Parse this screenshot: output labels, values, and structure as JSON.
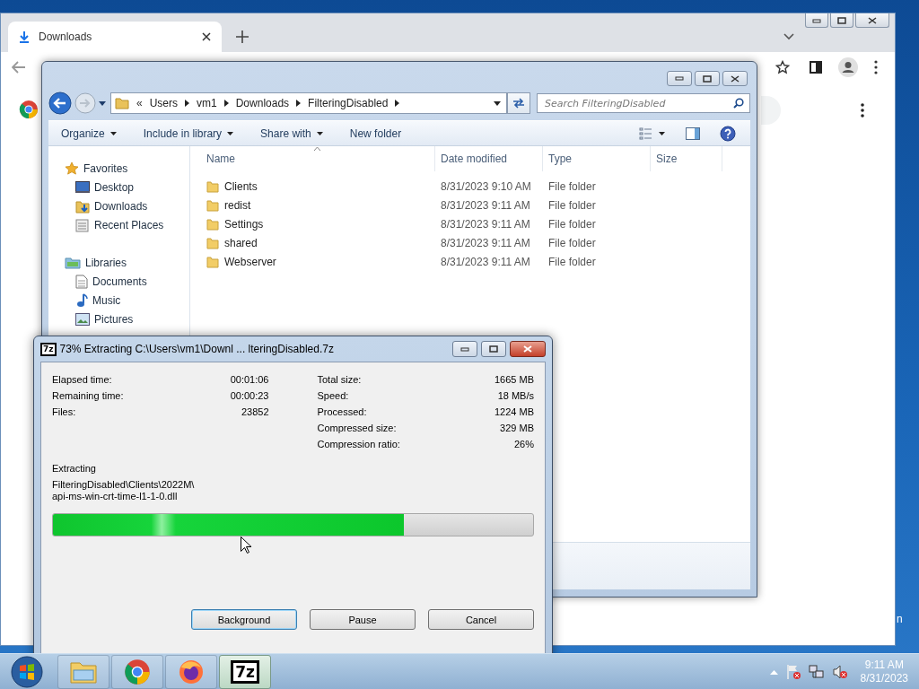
{
  "browser": {
    "tabs": [
      {
        "label": "Downloads",
        "selected": true
      }
    ]
  },
  "desktop": {
    "label_fragment": "n"
  },
  "explorer": {
    "address_overflow": "«",
    "breadcrumb": [
      "Users",
      "vm1",
      "Downloads",
      "FilteringDisabled"
    ],
    "search": {
      "placeholder": "Search FilteringDisabled"
    },
    "toolbar": [
      {
        "label": "Organize",
        "has_menu": true
      },
      {
        "label": "Include in library",
        "has_menu": true
      },
      {
        "label": "Share with",
        "has_menu": true
      },
      {
        "label": "New folder",
        "has_menu": false
      }
    ],
    "sidebar": [
      {
        "label": "Favorites",
        "kind": "favorites",
        "items": [
          {
            "label": "Desktop",
            "kind": "desktop"
          },
          {
            "label": "Downloads",
            "kind": "downloads"
          },
          {
            "label": "Recent Places",
            "kind": "recent"
          }
        ]
      },
      {
        "label": "Libraries",
        "kind": "libraries",
        "items": [
          {
            "label": "Documents",
            "kind": "documents"
          },
          {
            "label": "Music",
            "kind": "music"
          },
          {
            "label": "Pictures",
            "kind": "pictures"
          }
        ]
      }
    ],
    "columns": [
      "Name",
      "Date modified",
      "Type",
      "Size"
    ],
    "rows": [
      {
        "name": "Clients",
        "date": "8/31/2023 9:10 AM",
        "type": "File folder"
      },
      {
        "name": "redist",
        "date": "8/31/2023 9:11 AM",
        "type": "File folder"
      },
      {
        "name": "Settings",
        "date": "8/31/2023 9:11 AM",
        "type": "File folder"
      },
      {
        "name": "shared",
        "date": "8/31/2023 9:11 AM",
        "type": "File folder"
      },
      {
        "name": "Webserver",
        "date": "8/31/2023 9:11 AM",
        "type": "File folder"
      }
    ]
  },
  "extract_dialog": {
    "icon_label": "7z",
    "title": "73% Extracting C:\\Users\\vm1\\Downl ... lteringDisabled.7z",
    "stats_left": [
      {
        "label": "Elapsed time:",
        "value": "00:01:06"
      },
      {
        "label": "Remaining time:",
        "value": "00:00:23"
      },
      {
        "label": "Files:",
        "value": "23852"
      }
    ],
    "stats_right": [
      {
        "label": "Total size:",
        "value": "1665 MB"
      },
      {
        "label": "Speed:",
        "value": "18 MB/s"
      },
      {
        "label": "Processed:",
        "value": "1224 MB"
      },
      {
        "label": "Compressed size:",
        "value": "329 MB"
      },
      {
        "label": "Compression ratio:",
        "value": "26%"
      }
    ],
    "status_label": "Extracting",
    "current_file": [
      "FilteringDisabled\\Clients\\2022M\\",
      "api-ms-win-crt-time-l1-1-0.dll"
    ],
    "progress": {
      "level": 0.73
    },
    "buttons": [
      {
        "label": "Background",
        "default": true
      },
      {
        "label": "Pause",
        "default": false
      },
      {
        "label": "Cancel",
        "default": false
      }
    ]
  },
  "taskbar": {
    "apps": [
      {
        "kind": "explorer",
        "selected": false
      },
      {
        "kind": "chrome",
        "selected": false
      },
      {
        "kind": "firefox",
        "selected": false
      },
      {
        "kind": "sevenzip",
        "label": "7z",
        "selected": true
      }
    ],
    "clock": {
      "time": "9:11 AM",
      "date": "8/31/2023"
    }
  }
}
